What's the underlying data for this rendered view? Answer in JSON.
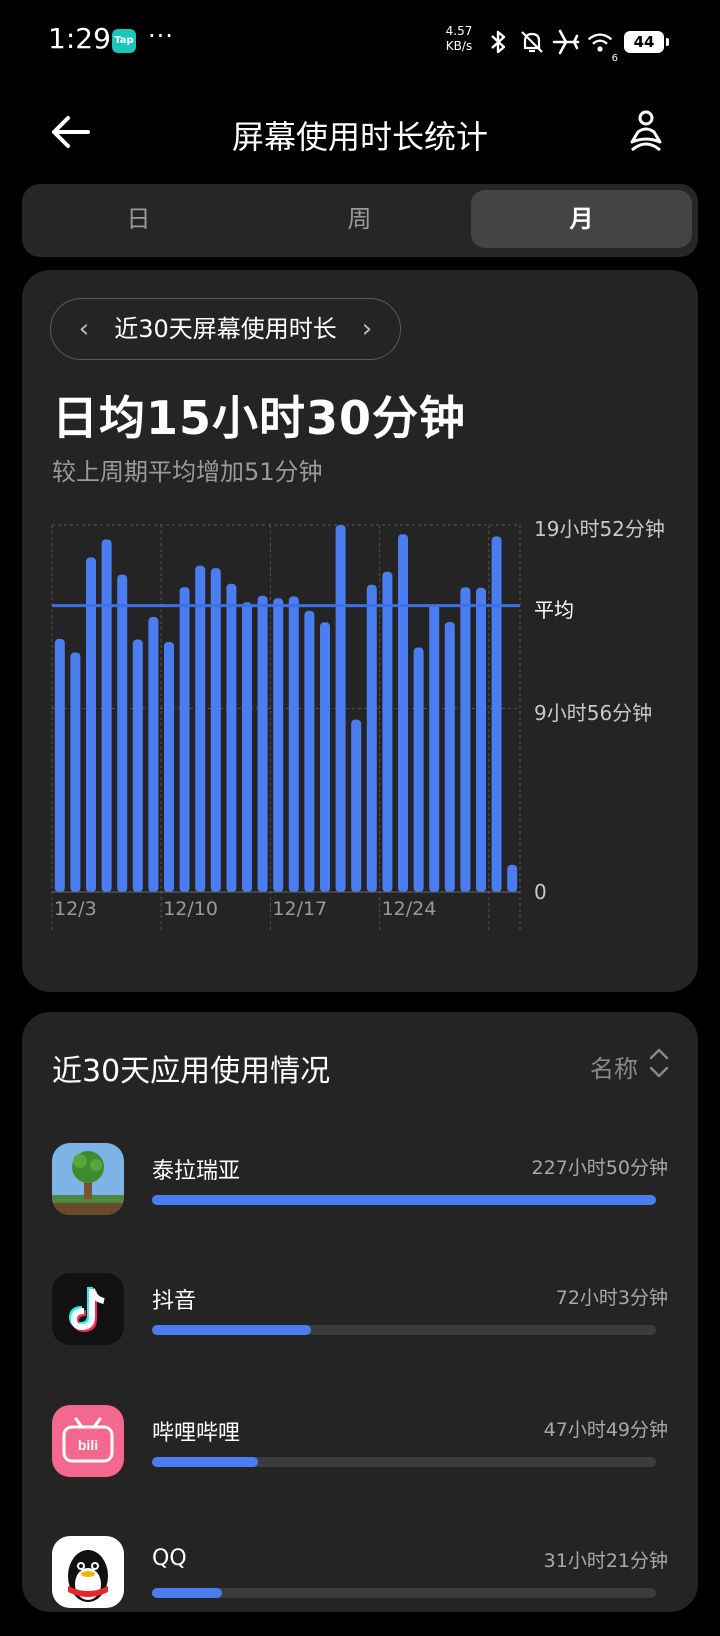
{
  "status_bar": {
    "time": "1:29",
    "tap_badge": "Tap",
    "more": "···",
    "net_speed_value": "4.57",
    "net_speed_unit": "KB/s",
    "wifi_badge": "6",
    "battery": "44"
  },
  "header": {
    "title": "屏幕使用时长统计"
  },
  "period_tabs": [
    {
      "label": "日",
      "active": false
    },
    {
      "label": "周",
      "active": false
    },
    {
      "label": "月",
      "active": true
    }
  ],
  "summary": {
    "range_label": "近30天屏幕使用时长",
    "daily_average": "日均15小时30分钟",
    "comparison": "较上周期平均增加51分钟"
  },
  "chart_data": {
    "type": "bar",
    "unit": "minutes",
    "x_ticks": [
      "12/3",
      "12/10",
      "12/17",
      "12/24"
    ],
    "y_ticks": [
      "0",
      "9小时56分钟",
      "19小时52分钟"
    ],
    "y_tick_values": [
      0,
      596,
      1192
    ],
    "ylim": [
      0,
      1192
    ],
    "average_label": "平均",
    "average": 930,
    "values": [
      822,
      778,
      1087,
      1145,
      1031,
      820,
      893,
      812,
      990,
      1060,
      1052,
      1001,
      941,
      962,
      954,
      960,
      913,
      876,
      1192,
      560,
      998,
      1040,
      1162,
      794,
      934,
      877,
      990,
      988,
      1155,
      88
    ],
    "grid": true,
    "bar_color": "#4a7ef0"
  },
  "apps_section": {
    "title": "近30天应用使用情况",
    "sort_label": "名称",
    "apps": [
      {
        "name": "泰拉瑞亚",
        "duration": "227小时50分钟",
        "fraction": 1.0,
        "icon": "terraria-icon"
      },
      {
        "name": "抖音",
        "duration": "72小时3分钟",
        "fraction": 0.316,
        "icon": "douyin-icon"
      },
      {
        "name": "哔哩哔哩",
        "duration": "47小时49分钟",
        "fraction": 0.21,
        "icon": "bilibili-icon"
      },
      {
        "name": "QQ",
        "duration": "31小时21分钟",
        "fraction": 0.138,
        "icon": "qq-icon"
      }
    ]
  },
  "colors": {
    "accent": "#4a7ef0",
    "card_bg": "#242424",
    "background": "#000000"
  }
}
